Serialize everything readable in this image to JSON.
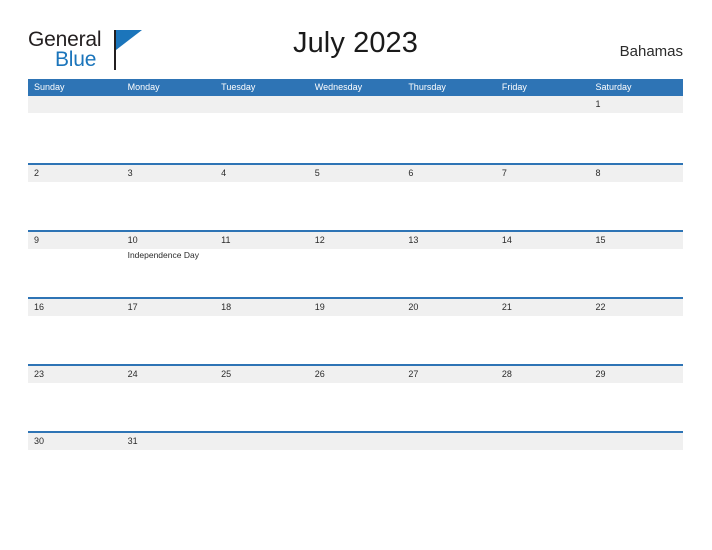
{
  "brand": {
    "word_one": "General",
    "word_two": "Blue",
    "flag_icon": "flag-triangle-icon",
    "accent_color": "#1b75bb"
  },
  "header": {
    "title": "July 2023",
    "country": "Bahamas"
  },
  "theme": {
    "header_blue": "#2e74b5",
    "band_gray": "#f0f0f0",
    "page_background": "#ffffff",
    "text_dark": "#2b2b2b"
  },
  "calendar": {
    "month": "July",
    "year": "2023",
    "weekdays": [
      "Sunday",
      "Monday",
      "Tuesday",
      "Wednesday",
      "Thursday",
      "Friday",
      "Saturday"
    ],
    "weeks": [
      [
        {
          "day": "",
          "event": ""
        },
        {
          "day": "",
          "event": ""
        },
        {
          "day": "",
          "event": ""
        },
        {
          "day": "",
          "event": ""
        },
        {
          "day": "",
          "event": ""
        },
        {
          "day": "",
          "event": ""
        },
        {
          "day": "1",
          "event": ""
        }
      ],
      [
        {
          "day": "2",
          "event": ""
        },
        {
          "day": "3",
          "event": ""
        },
        {
          "day": "4",
          "event": ""
        },
        {
          "day": "5",
          "event": ""
        },
        {
          "day": "6",
          "event": ""
        },
        {
          "day": "7",
          "event": ""
        },
        {
          "day": "8",
          "event": ""
        }
      ],
      [
        {
          "day": "9",
          "event": ""
        },
        {
          "day": "10",
          "event": "Independence Day"
        },
        {
          "day": "11",
          "event": ""
        },
        {
          "day": "12",
          "event": ""
        },
        {
          "day": "13",
          "event": ""
        },
        {
          "day": "14",
          "event": ""
        },
        {
          "day": "15",
          "event": ""
        }
      ],
      [
        {
          "day": "16",
          "event": ""
        },
        {
          "day": "17",
          "event": ""
        },
        {
          "day": "18",
          "event": ""
        },
        {
          "day": "19",
          "event": ""
        },
        {
          "day": "20",
          "event": ""
        },
        {
          "day": "21",
          "event": ""
        },
        {
          "day": "22",
          "event": ""
        }
      ],
      [
        {
          "day": "23",
          "event": ""
        },
        {
          "day": "24",
          "event": ""
        },
        {
          "day": "25",
          "event": ""
        },
        {
          "day": "26",
          "event": ""
        },
        {
          "day": "27",
          "event": ""
        },
        {
          "day": "28",
          "event": ""
        },
        {
          "day": "29",
          "event": ""
        }
      ],
      [
        {
          "day": "30",
          "event": ""
        },
        {
          "day": "31",
          "event": ""
        },
        {
          "day": "",
          "event": ""
        },
        {
          "day": "",
          "event": ""
        },
        {
          "day": "",
          "event": ""
        },
        {
          "day": "",
          "event": ""
        },
        {
          "day": "",
          "event": ""
        }
      ]
    ]
  }
}
